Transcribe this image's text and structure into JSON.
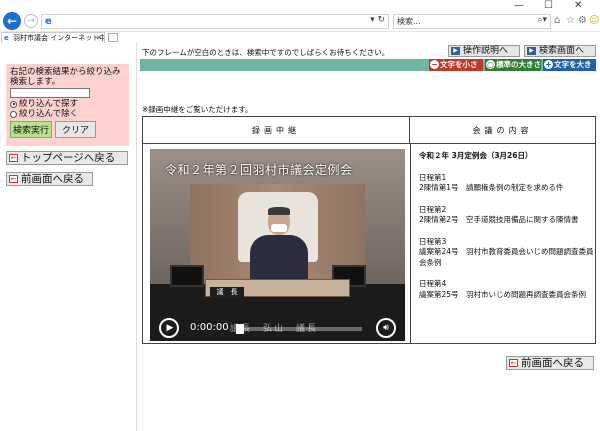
{
  "browser": {
    "search_placeholder": "検索...",
    "tab_title": "羽村市議会 インターネット中継",
    "window_controls": [
      "—",
      "☐",
      "✕"
    ],
    "toolbar_icons": [
      "home-icon",
      "star-icon",
      "gear-icon",
      "smiley-icon"
    ]
  },
  "left": {
    "filter_text": "右記の検索結果から絞り込み検索します。",
    "radio_narrow": "絞り込んで探す",
    "radio_exclude": "絞り込んで除く",
    "search_button": "検索実行",
    "clear_button": "クリア",
    "top_page_link": "トップページへ戻る",
    "prev_page_link": "前画面へ戻る"
  },
  "right": {
    "frame_note": "下のフレームが空白のときは、検索中ですのでしばらくお待ちください。",
    "guide_button": "操作説明へ",
    "search_screen_button": "検索画面へ",
    "font_small": "文字を小さく",
    "font_standard": "標準の大きさ",
    "font_large": "文字を大きく",
    "notice": "※録画中継をご覧いただけます。",
    "col_video": "録画中継",
    "col_agenda": "会議の内容",
    "video": {
      "overlay_title": "令和２年第２回羽村市議会定例会",
      "caption": "議長　弘山　議長",
      "nameplate": "議　長",
      "time": "0:00:00",
      "progress": 0
    },
    "agenda": {
      "session": "令和２年 3月定例会（3月26日）",
      "items": [
        {
          "day": "日程第1",
          "detail": "2陳情第1号　請願権条例の制定を求める件"
        },
        {
          "day": "日程第2",
          "detail": "2陳情第2号　空手道競技用備品に関する陳情書"
        },
        {
          "day": "日程第3",
          "detail": "議案第24号　羽村市教育委員会いじめ問題調査委員会条例"
        },
        {
          "day": "日程第4",
          "detail": "議案第25号　羽村市いじめ問題再調査委員会条例"
        }
      ]
    },
    "bottom_back_button": "前画面へ戻る"
  }
}
